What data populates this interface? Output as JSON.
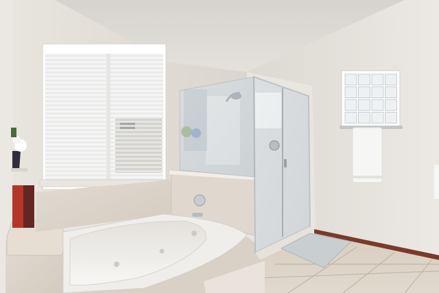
{
  "scene": {
    "kind": "bathroom-photo",
    "palette": {
      "ceiling": "#dedbd6",
      "wall_left": "#e6e2dc",
      "wall_right": "#e9e6e1",
      "marble": "#ddd5cc",
      "tub": "#f3f1ee",
      "glass": "#d7dde0",
      "floor": "#d9d0c4",
      "baseboard": "#7a3a2a",
      "window_light": "#f4f5f5",
      "towel": "#f6f6f4",
      "rug": "#c9cfd0",
      "trash_can": "#b5372b"
    }
  }
}
